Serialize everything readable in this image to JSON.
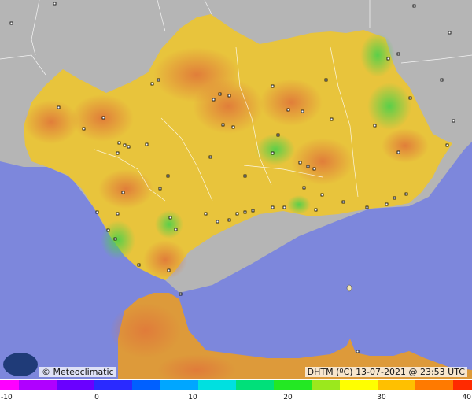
{
  "map": {
    "credit": "© Meteoclimatic",
    "parameter_label": "DHTM (ºC)",
    "timestamp": "13-07-2021 @ 23:53 UTC",
    "colors": {
      "sea": "#7d87dc",
      "land_outside": "#b4b4b4",
      "region_base": "#e8c83c",
      "warm": "#e58a3c",
      "cool": "#57d148"
    }
  },
  "scale": {
    "min": -10,
    "max": 40,
    "ticks": [
      "-10",
      "0",
      "10",
      "20",
      "30",
      "40"
    ],
    "colors": [
      "#ff00ff",
      "#b000ff",
      "#6a00ff",
      "#2a2aff",
      "#0060ff",
      "#00a6ff",
      "#00e0e0",
      "#00e07a",
      "#23e823",
      "#9be81d",
      "#ffff00",
      "#ffc000",
      "#ff7a00",
      "#ff2a00"
    ]
  }
}
